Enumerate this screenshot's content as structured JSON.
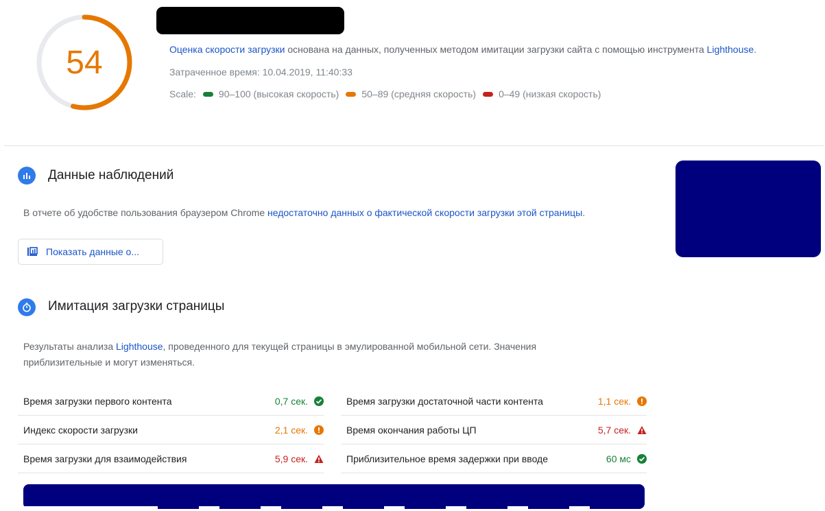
{
  "header": {
    "score": "54",
    "score_fraction": 0.54,
    "score_color": "#e67700",
    "description_link": "Оценка скорости загрузки",
    "description_text": " основана на данных, полученных методом имитации загрузки сайта с помощью инструмента ",
    "description_tool": "Lighthouse",
    "description_end": ".",
    "time": "Затраченное время: 10.04.2019, 11:40:33",
    "scale_label": "Scale:",
    "scale": [
      {
        "range": "90–100 (высокая скорость)",
        "color": "#188038"
      },
      {
        "range": "50–89 (средняя скорость)",
        "color": "#e67700"
      },
      {
        "range": "0–49 (низкая скорость)",
        "color": "#c5221f"
      }
    ]
  },
  "field": {
    "title": "Данные наблюдений",
    "text_before": "В отчете об удобстве пользования браузером Chrome ",
    "text_link": "недостаточно данных о фактической скорости загрузки этой страницы",
    "text_after": ".",
    "button": "Показать данные о..."
  },
  "lab": {
    "title": "Имитация загрузки страницы",
    "text_before": "Результаты анализа ",
    "text_link": "Lighthouse",
    "text_after": ", проведенного для текущей страницы в эмулированной мобильной сети. Значения приблизительные и могут изменяться.",
    "metrics_left": [
      {
        "name": "Время загрузки первого контента",
        "value": "0,7 сек.",
        "status": "good"
      },
      {
        "name": "Индекс скорости загрузки",
        "value": "2,1 сек.",
        "status": "average"
      },
      {
        "name": "Время загрузки для взаимодействия",
        "value": "5,9 сек.",
        "status": "poor"
      }
    ],
    "metrics_right": [
      {
        "name": "Время загрузки достаточной части контента",
        "value": "1,1 сек.",
        "status": "average"
      },
      {
        "name": "Время окончания работы ЦП",
        "value": "5,7 сек.",
        "status": "poor"
      },
      {
        "name": "Приблизительное время задержки при вводе",
        "value": "60 мс",
        "status": "good"
      }
    ]
  },
  "colors": {
    "good": "#188038",
    "average": "#e67700",
    "poor": "#c5221f",
    "link": "#1a55c7"
  },
  "icons": {
    "good": "check-circle-icon",
    "average": "info-circle-icon",
    "poor": "warning-triangle-icon"
  }
}
